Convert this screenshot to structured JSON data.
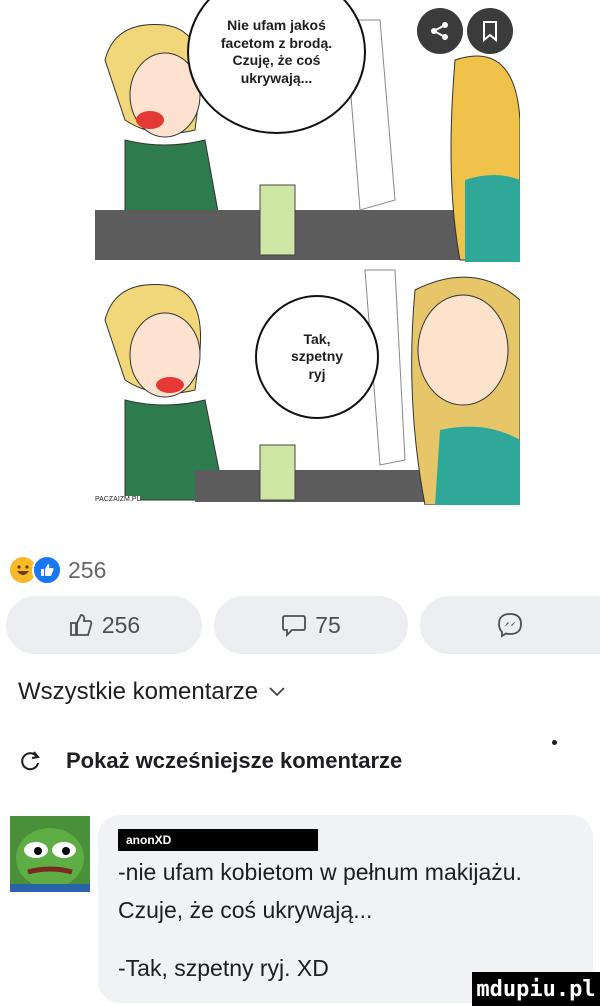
{
  "comic": {
    "panel1_bubble": "Nie ufam jakoś\nfacetom z brodą.\nCzuję, że coś\nukrywają...",
    "panel2_bubble": "Tak,\nszpetny\nryj",
    "credit": "PACZAIZM.PL"
  },
  "overlay_buttons": [
    {
      "icon": "share-icon"
    },
    {
      "icon": "save-icon"
    }
  ],
  "reactions": {
    "icons": [
      "haha-emoji-icon",
      "like-reaction-icon"
    ],
    "count": "256"
  },
  "actions": {
    "like_count": "256",
    "comment_count": "75"
  },
  "comments_filter": {
    "label": "Wszystkie komentarze"
  },
  "show_previous": {
    "label": "Pokaż wcześniejsze komentarze"
  },
  "comment": {
    "author": "anonXD",
    "line1": "-nie ufam kobietom w pełnum makijażu.",
    "line2": "Czuje, że coś ukrywają...",
    "line3": "-Tak, szpetny ryj. XD"
  },
  "watermark": "mdupiu.pl"
}
